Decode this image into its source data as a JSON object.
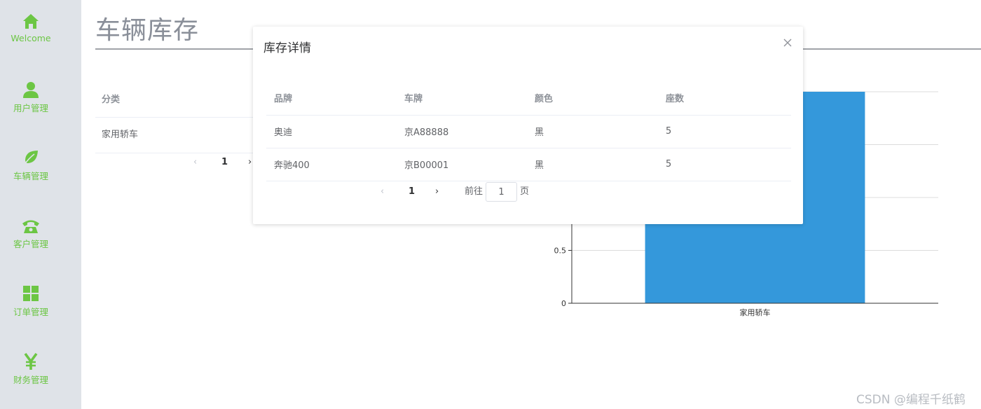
{
  "sidebar": {
    "items": [
      {
        "label": "Welcome",
        "icon": "home-icon"
      },
      {
        "label": "用户管理",
        "icon": "user-icon"
      },
      {
        "label": "车辆管理",
        "icon": "leaf-icon"
      },
      {
        "label": "客户管理",
        "icon": "phone-icon"
      },
      {
        "label": "订单管理",
        "icon": "grid-icon"
      },
      {
        "label": "财务管理",
        "icon": "yen-icon"
      }
    ],
    "accent_color": "#6cc644"
  },
  "page": {
    "title": "车辆库存"
  },
  "background_table": {
    "header": "分类",
    "row": "家用轿车",
    "pager_page": "1",
    "prev_glyph": "‹",
    "next_glyph": "›"
  },
  "dialog": {
    "title": "库存详情",
    "close_glyph": "×",
    "columns": [
      "品牌",
      "车牌",
      "颜色",
      "座数"
    ],
    "rows": [
      [
        "奥迪",
        "京A88888",
        "黑",
        "5"
      ],
      [
        "奔驰400",
        "京B00001",
        "黑",
        "5"
      ]
    ],
    "pagination": {
      "prev": "‹",
      "current": "1",
      "next": "›",
      "goto_label": "前往",
      "goto_value": "1",
      "page_suffix": "页"
    }
  },
  "chart_data": {
    "type": "bar",
    "categories": [
      "家用轿车"
    ],
    "values": [
      2
    ],
    "y_ticks": [
      "0",
      "0.5"
    ],
    "ylim": [
      0,
      2
    ],
    "bar_color": "#3498db",
    "grid": true
  },
  "watermark": "CSDN @编程千纸鹤"
}
